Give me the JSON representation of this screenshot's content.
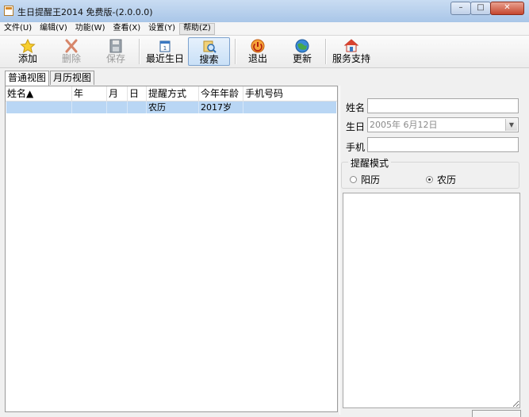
{
  "window": {
    "title": "生日提醒王2014 免费版-(2.0.0.0)",
    "controls": [
      "–",
      "□",
      "✕"
    ]
  },
  "menu": [
    "文件(U)",
    "编辑(V)",
    "功能(W)",
    "查看(X)",
    "设置(Y)",
    "帮助(Z)"
  ],
  "toolbar": {
    "add": "添加",
    "delete": "删除",
    "save": "保存",
    "recent": "最近生日",
    "search": "搜索",
    "exit": "退出",
    "update": "更新",
    "support": "服务支持"
  },
  "tabs": [
    "普通视图",
    "月历视图"
  ],
  "table": {
    "headers": [
      "姓名▲",
      "年",
      "月",
      "日",
      "提醒方式",
      "今年年龄",
      "手机号码"
    ],
    "rows": [
      [
        "",
        "",
        "",
        "",
        "农历",
        "2017岁",
        ""
      ]
    ]
  },
  "form": {
    "name_label": "姓名",
    "name_value": "",
    "birthday_label": "生日",
    "birthday_value": "2005年 6月12日",
    "phone_label": "手机",
    "phone_value": "",
    "mode_title": "提醒模式",
    "mode_solar": "阳历",
    "mode_lunar": "农历",
    "mode_selected": "农历"
  },
  "colors": {
    "selection": "#b9d6f4",
    "titlebar": "#bcd3ee",
    "close": "#c5462e"
  }
}
